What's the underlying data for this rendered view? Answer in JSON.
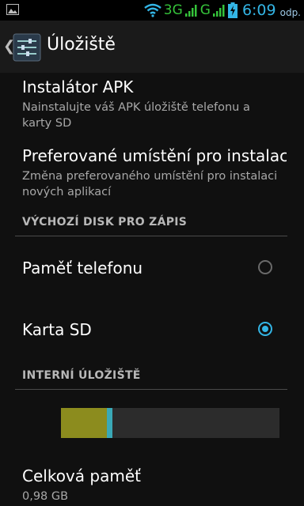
{
  "status_bar": {
    "network_1": "3G",
    "network_2": "G",
    "time": "6:09",
    "carrier": "odp.",
    "icons": [
      "image-icon",
      "wifi-icon",
      "signal-icon",
      "signal-icon",
      "battery-charging-icon"
    ],
    "accent": "#33b5e5",
    "network_color": "#35c33a"
  },
  "action_bar": {
    "title": "Úložiště",
    "icons": [
      "back-chevron-icon",
      "storage-settings-icon"
    ]
  },
  "items": [
    {
      "title": "Instalátor APK",
      "subtitle": "Nainstalujte váš APK úložiště telefonu a karty SD"
    },
    {
      "title": "Preferované umístění pro instalaci",
      "subtitle": "Změna preferovaného umístění pro instalaci nových aplikací"
    }
  ],
  "sections": {
    "write_disk": "VÝCHOZÍ DISK PRO ZÁPIS",
    "internal_storage": "INTERNÍ ÚLOŽIŠTĚ"
  },
  "radio_options": [
    {
      "label": "Paměť telefonu",
      "checked": false
    },
    {
      "label": "Karta SD",
      "checked": true
    }
  ],
  "storage_bar": {
    "segments": [
      {
        "name": "apps",
        "fraction": 0.21,
        "color": "#8c8c1e"
      },
      {
        "name": "other",
        "fraction": 0.025,
        "color": "#3aa9b7"
      }
    ]
  },
  "total": {
    "label": "Celková paměť",
    "value": "0,98 GB"
  }
}
